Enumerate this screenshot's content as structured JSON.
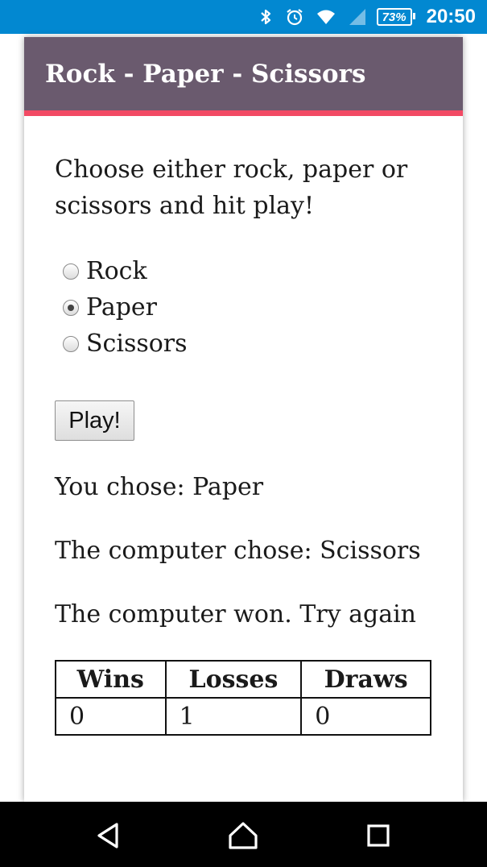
{
  "status_bar": {
    "battery": "73%",
    "time": "20:50",
    "icons": [
      "bluetooth-icon",
      "alarm-icon",
      "wifi-icon",
      "signal-icon",
      "battery-icon"
    ]
  },
  "app": {
    "title": "Rock - Paper - Scissors"
  },
  "instructions": "Choose either rock, paper or scissors and hit play!",
  "options": [
    {
      "label": "Rock",
      "checked": false
    },
    {
      "label": "Paper",
      "checked": true
    },
    {
      "label": "Scissors",
      "checked": false
    }
  ],
  "play_label": "Play!",
  "results": {
    "you_chose": "You chose: Paper",
    "computer_chose": "The computer chose: Scissors",
    "outcome": "The computer won. Try again"
  },
  "score": {
    "headers": [
      "Wins",
      "Losses",
      "Draws"
    ],
    "values": [
      "0",
      "1",
      "0"
    ]
  },
  "nav_bar": {
    "buttons": [
      "back-icon",
      "home-icon",
      "recents-icon"
    ]
  },
  "colors": {
    "status_bar": "#0288d1",
    "app_bar": "#6a5a6e",
    "accent": "#f24a64"
  }
}
